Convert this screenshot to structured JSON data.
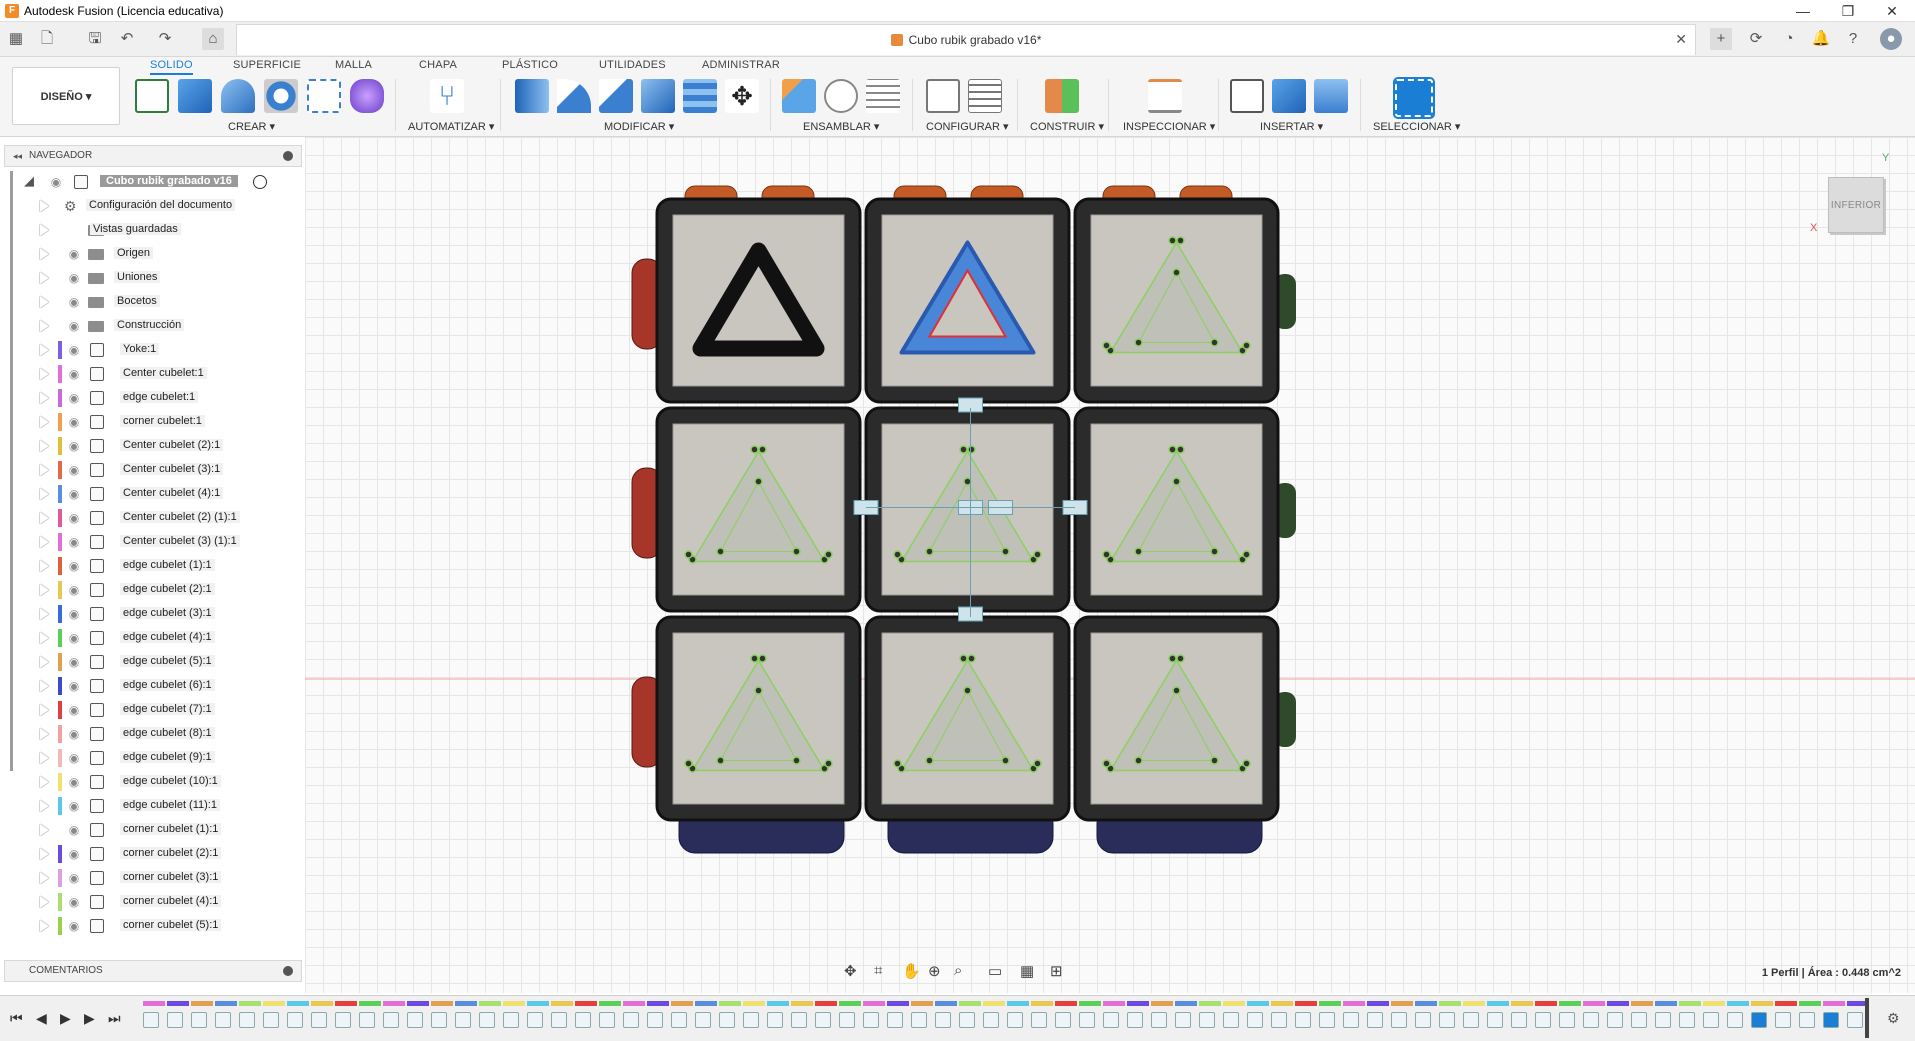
{
  "window": {
    "title": "Autodesk Fusion (Licencia educativa)",
    "controls": [
      "—",
      "❐",
      "✕"
    ]
  },
  "document_tab": {
    "name": "Cubo rubik grabado v16*"
  },
  "ribbon": {
    "tabs": [
      "SOLIDO",
      "SUPERFICIE",
      "MALLA",
      "CHAPA",
      "PLÁSTICO",
      "UTILIDADES",
      "ADMINISTRAR"
    ],
    "active_tab": "SOLIDO",
    "workspace": "DISEÑO ▾",
    "groups": [
      "CREAR ▾",
      "AUTOMATIZAR ▾",
      "MODIFICAR ▾",
      "ENSAMBLAR ▾",
      "CONFIGURAR ▾",
      "CONSTRUIR ▾",
      "INSPECCIONAR ▾",
      "INSERTAR ▾",
      "SELECCIONAR ▾"
    ]
  },
  "browser": {
    "header": "NAVEGADOR",
    "root": "Cubo rubik grabado v16",
    "items": [
      {
        "label": "Configuración del documento",
        "kind": "gear",
        "color": ""
      },
      {
        "label": "Vistas guardadas",
        "kind": "folder",
        "color": ""
      },
      {
        "label": "Origen",
        "kind": "folder",
        "color": ""
      },
      {
        "label": "Uniones",
        "kind": "folder",
        "color": ""
      },
      {
        "label": "Bocetos",
        "kind": "folder",
        "color": ""
      },
      {
        "label": "Construcción",
        "kind": "folder",
        "color": ""
      },
      {
        "label": "Yoke:1",
        "kind": "comp",
        "color": "#7d5fe3"
      },
      {
        "label": "Center cubelet:1",
        "kind": "comp",
        "color": "#e06fd8"
      },
      {
        "label": "edge cubelet:1",
        "kind": "comp",
        "color": "#c86ad8"
      },
      {
        "label": "corner cubelet:1",
        "kind": "comp",
        "color": "#f0a04b"
      },
      {
        "label": "Center cubelet (2):1",
        "kind": "comp",
        "color": "#e0c03a"
      },
      {
        "label": "Center cubelet (3):1",
        "kind": "comp",
        "color": "#e06a4a"
      },
      {
        "label": "Center cubelet (4):1",
        "kind": "comp",
        "color": "#5a8de0"
      },
      {
        "label": "Center cubelet (2) (1):1",
        "kind": "comp",
        "color": "#e05a9a"
      },
      {
        "label": "Center cubelet (3) (1):1",
        "kind": "comp",
        "color": "#e06fd8"
      },
      {
        "label": "edge cubelet (1):1",
        "kind": "comp",
        "color": "#e0603a"
      },
      {
        "label": "edge cubelet (2):1",
        "kind": "comp",
        "color": "#e8c850"
      },
      {
        "label": "edge cubelet (3):1",
        "kind": "comp",
        "color": "#3a6ae0"
      },
      {
        "label": "edge cubelet (4):1",
        "kind": "comp",
        "color": "#5ad05a"
      },
      {
        "label": "edge cubelet (5):1",
        "kind": "comp",
        "color": "#e0a050"
      },
      {
        "label": "edge cubelet (6):1",
        "kind": "comp",
        "color": "#3a4ac8"
      },
      {
        "label": "edge cubelet (7):1",
        "kind": "comp",
        "color": "#e04040"
      },
      {
        "label": "edge cubelet (8):1",
        "kind": "comp",
        "color": "#f2a0a0"
      },
      {
        "label": "edge cubelet (9):1",
        "kind": "comp",
        "color": "#f4b8b8"
      },
      {
        "label": "edge cubelet (10):1",
        "kind": "comp",
        "color": "#f0e070"
      },
      {
        "label": "edge cubelet (11):1",
        "kind": "comp",
        "color": "#5ac8e8"
      },
      {
        "label": "corner cubelet (1):1",
        "kind": "comp",
        "color": ""
      },
      {
        "label": "corner cubelet (2):1",
        "kind": "comp",
        "color": "#6a4ae0"
      },
      {
        "label": "corner cubelet (3):1",
        "kind": "comp",
        "color": "#e0a0e0"
      },
      {
        "label": "corner cubelet (4):1",
        "kind": "comp",
        "color": "#a8e070"
      },
      {
        "label": "corner cubelet (5):1",
        "kind": "comp",
        "color": "#9ad04a"
      }
    ]
  },
  "comments": {
    "header": "COMENTARIOS"
  },
  "viewcube": {
    "face": "INFERIOR",
    "axis_x": "X",
    "axis_y": "Y"
  },
  "status": {
    "selection": "1 Perfil | Área : 0.448 cm^2"
  },
  "timeline": {
    "buttons": [
      "⏮",
      "◀",
      "▶",
      "▶",
      "⏭"
    ]
  }
}
